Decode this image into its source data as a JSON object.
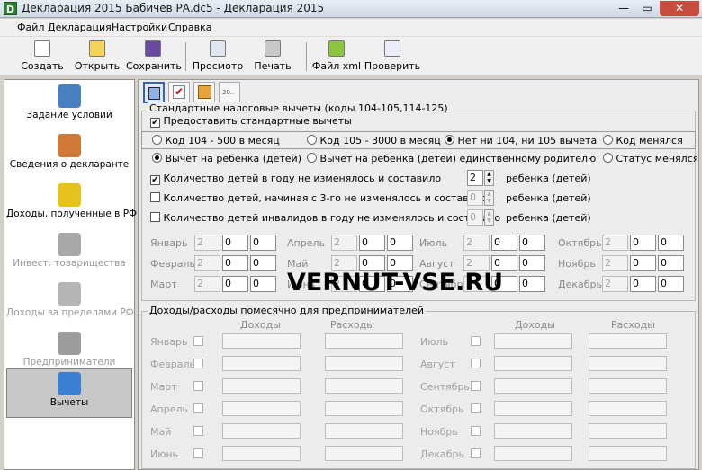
{
  "window": {
    "title": "Декларация 2015 Бабичев РА.dc5 - Декларация 2015",
    "icon_letter": "D",
    "min": "—",
    "max": "▭",
    "close": "✕"
  },
  "menu": [
    "Файл",
    "Декларация",
    "Настройки",
    "Справка"
  ],
  "toolbar": {
    "create": "Создать",
    "open": "Открыть",
    "save": "Сохранить",
    "preview": "Просмотр",
    "print": "Печать",
    "file_xml": "Файл xml",
    "check": "Проверить"
  },
  "sidebar": {
    "items": [
      {
        "label": "Задание условий",
        "enabled": true
      },
      {
        "label": "Сведения о декларанте",
        "enabled": true
      },
      {
        "label": "Доходы, полученные в РФ",
        "enabled": true
      },
      {
        "label": "Инвест. товарищества",
        "enabled": false
      },
      {
        "label": "Доходы за пределами РФ",
        "enabled": false
      },
      {
        "label": "Предприниматели",
        "enabled": false
      },
      {
        "label": "Вычеты",
        "enabled": true,
        "active": true
      }
    ]
  },
  "tabs": {
    "small_label": "20.."
  },
  "std": {
    "group_title": "Стандартные налоговые вычеты (коды 104-105,114-125)",
    "provide": "Предоставить стандартные вычеты",
    "provide_mark": "✔",
    "code_options": [
      "Код 104 - 500 в месяц",
      "Код 105 - 3000 в месяц",
      "Нет ни 104, ни 105 вычета",
      "Код менялся"
    ],
    "child_options": [
      "Вычет на ребенка (детей)",
      "Вычет на ребенка (детей) единственному родителю",
      "Статус менялся"
    ],
    "children": [
      {
        "label": "Количество детей в году не изменялось и составило",
        "checked": true,
        "value": "2",
        "suffix": "ребенка (детей)"
      },
      {
        "label": "Количество детей, начиная с 3-го не изменялось и составило",
        "checked": false,
        "value": "0",
        "suffix": "ребенка (детей)"
      },
      {
        "label": "Количество детей инвалидов в году не изменялось и составило",
        "checked": false,
        "value": "0",
        "suffix": "ребенка (детей)"
      }
    ],
    "months": [
      {
        "name": "Январь",
        "v": [
          "2",
          "0",
          "0"
        ]
      },
      {
        "name": "Февраль",
        "v": [
          "2",
          "0",
          "0"
        ]
      },
      {
        "name": "Март",
        "v": [
          "2",
          "0",
          "0"
        ]
      },
      {
        "name": "Апрель",
        "v": [
          "2",
          "0",
          "0"
        ]
      },
      {
        "name": "Май",
        "v": [
          "2",
          "0",
          "0"
        ]
      },
      {
        "name": "Июнь",
        "v": [
          "2",
          "0",
          "0"
        ]
      },
      {
        "name": "Июль",
        "v": [
          "2",
          "0",
          "0"
        ]
      },
      {
        "name": "Август",
        "v": [
          "2",
          "0",
          "0"
        ]
      },
      {
        "name": "Сентябрь",
        "v": [
          "2",
          "0",
          "0"
        ]
      },
      {
        "name": "Октябрь",
        "v": [
          "2",
          "0",
          "0"
        ]
      },
      {
        "name": "Ноябрь",
        "v": [
          "2",
          "0",
          "0"
        ]
      },
      {
        "name": "Декабрь",
        "v": [
          "2",
          "0",
          "0"
        ]
      }
    ]
  },
  "entrepreneur": {
    "group_title": "Доходы/расходы помесячно для предпринимателей",
    "col_income": "Доходы",
    "col_expense": "Расходы",
    "left_months": [
      "Январь",
      "Февраль",
      "Март",
      "Апрель",
      "Май",
      "Июнь"
    ],
    "right_months": [
      "Июль",
      "Август",
      "Сентябрь",
      "Октябрь",
      "Ноябрь",
      "Декабрь"
    ]
  },
  "watermark": "VERNUT-VSE.RU",
  "colors": {
    "accent": "#3366aa",
    "close": "#c94c3f",
    "active_side": "#c7c7c7"
  }
}
